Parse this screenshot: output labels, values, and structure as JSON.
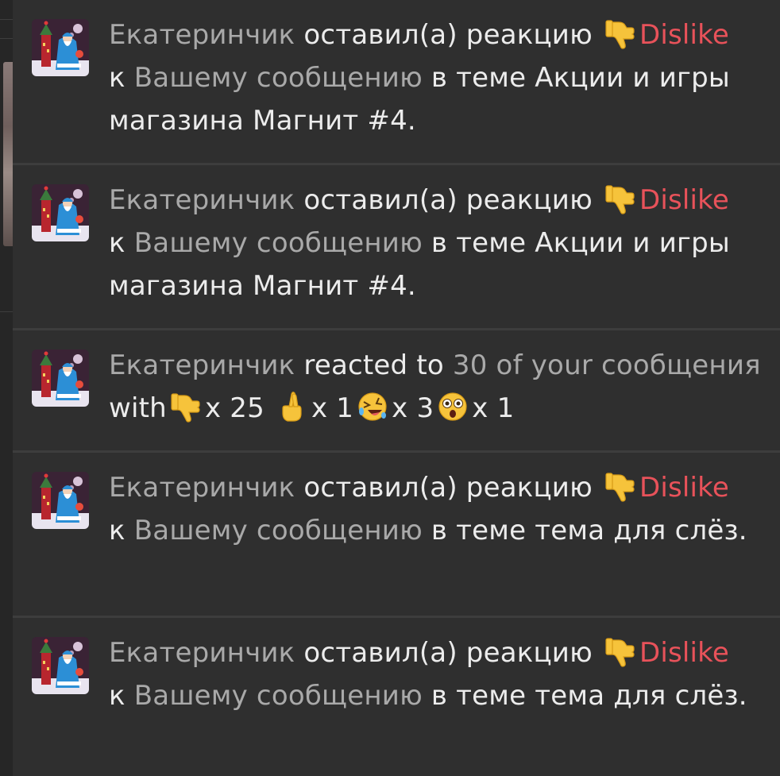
{
  "notifications": [
    {
      "user": "Екатеринчик",
      "action": "оставил(а) реакцию",
      "reaction_label": "Dislike",
      "to_prefix": "к",
      "message_link": "Вашему сообщению",
      "in_topic": "в теме",
      "topic": "Акции и игры магазина Магнит #4."
    },
    {
      "user": "Екатеринчик",
      "action": "оставил(а) реакцию",
      "reaction_label": "Dislike",
      "to_prefix": "к",
      "message_link": "Вашему сообщению",
      "in_topic": "в теме",
      "topic": "Акции и игры магазина Магнит #4."
    },
    {
      "user": "Екатеринчик",
      "reacted_to": "reacted to",
      "count_link": "30 of your сообщения",
      "with": "with",
      "reactions": [
        {
          "icon": "thumbs-down-icon",
          "count": "x 25"
        },
        {
          "icon": "crossed-fingers-icon",
          "count": "x 1"
        },
        {
          "icon": "rofl-icon",
          "count": "x 3"
        },
        {
          "icon": "astonished-face-icon",
          "count": "x 1"
        }
      ]
    },
    {
      "user": "Екатеринчик",
      "action": "оставил(а) реакцию",
      "reaction_label": "Dislike",
      "to_prefix": "к",
      "message_link": "Вашему сообщению",
      "in_topic": "в теме",
      "topic": "тема для слёз."
    },
    {
      "user": "Екатеринчик",
      "action": "оставил(а) реакцию",
      "reaction_label": "Dislike",
      "to_prefix": "к",
      "message_link": "Вашему сообщению",
      "in_topic": "в теме",
      "topic": "тема для слёз."
    }
  ],
  "colors": {
    "background": "#2f2f2f",
    "divider": "#3d3d3d",
    "text": "#ececec",
    "link_muted": "#a9a9a9",
    "dislike": "#e8525a"
  }
}
